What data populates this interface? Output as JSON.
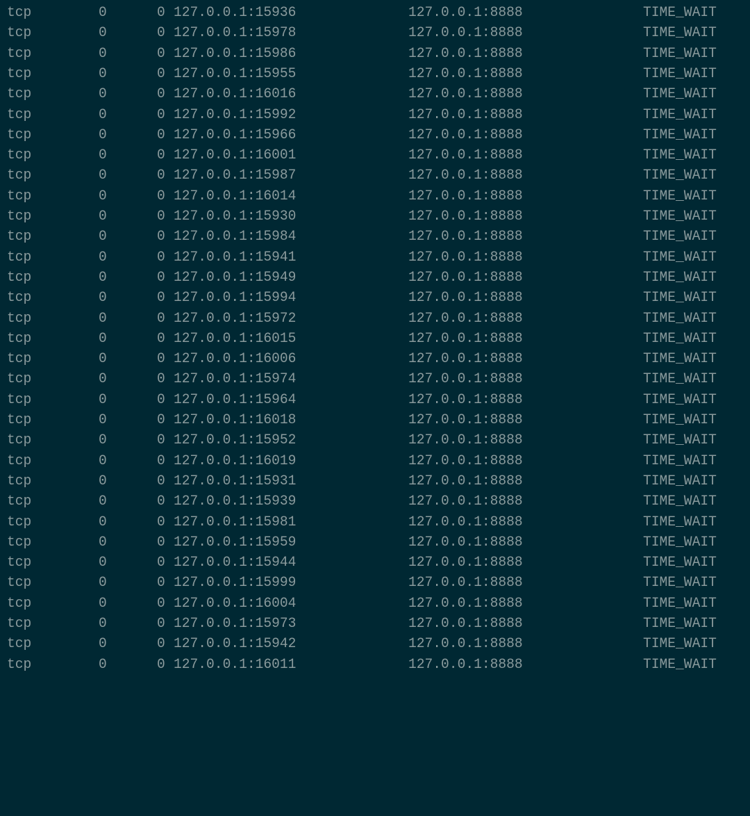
{
  "window": {
    "type": "terminal",
    "command_output": "netstat"
  },
  "theme": {
    "background": "#002833",
    "foreground": "#8a9a9c"
  },
  "connections": [
    {
      "proto": "tcp",
      "recv_q": "0",
      "send_q": "0",
      "local_address": "127.0.0.1:15936",
      "foreign_address": "127.0.0.1:8888",
      "state": "TIME_WAIT"
    },
    {
      "proto": "tcp",
      "recv_q": "0",
      "send_q": "0",
      "local_address": "127.0.0.1:15978",
      "foreign_address": "127.0.0.1:8888",
      "state": "TIME_WAIT"
    },
    {
      "proto": "tcp",
      "recv_q": "0",
      "send_q": "0",
      "local_address": "127.0.0.1:15986",
      "foreign_address": "127.0.0.1:8888",
      "state": "TIME_WAIT"
    },
    {
      "proto": "tcp",
      "recv_q": "0",
      "send_q": "0",
      "local_address": "127.0.0.1:15955",
      "foreign_address": "127.0.0.1:8888",
      "state": "TIME_WAIT"
    },
    {
      "proto": "tcp",
      "recv_q": "0",
      "send_q": "0",
      "local_address": "127.0.0.1:16016",
      "foreign_address": "127.0.0.1:8888",
      "state": "TIME_WAIT"
    },
    {
      "proto": "tcp",
      "recv_q": "0",
      "send_q": "0",
      "local_address": "127.0.0.1:15992",
      "foreign_address": "127.0.0.1:8888",
      "state": "TIME_WAIT"
    },
    {
      "proto": "tcp",
      "recv_q": "0",
      "send_q": "0",
      "local_address": "127.0.0.1:15966",
      "foreign_address": "127.0.0.1:8888",
      "state": "TIME_WAIT"
    },
    {
      "proto": "tcp",
      "recv_q": "0",
      "send_q": "0",
      "local_address": "127.0.0.1:16001",
      "foreign_address": "127.0.0.1:8888",
      "state": "TIME_WAIT"
    },
    {
      "proto": "tcp",
      "recv_q": "0",
      "send_q": "0",
      "local_address": "127.0.0.1:15987",
      "foreign_address": "127.0.0.1:8888",
      "state": "TIME_WAIT"
    },
    {
      "proto": "tcp",
      "recv_q": "0",
      "send_q": "0",
      "local_address": "127.0.0.1:16014",
      "foreign_address": "127.0.0.1:8888",
      "state": "TIME_WAIT"
    },
    {
      "proto": "tcp",
      "recv_q": "0",
      "send_q": "0",
      "local_address": "127.0.0.1:15930",
      "foreign_address": "127.0.0.1:8888",
      "state": "TIME_WAIT"
    },
    {
      "proto": "tcp",
      "recv_q": "0",
      "send_q": "0",
      "local_address": "127.0.0.1:15984",
      "foreign_address": "127.0.0.1:8888",
      "state": "TIME_WAIT"
    },
    {
      "proto": "tcp",
      "recv_q": "0",
      "send_q": "0",
      "local_address": "127.0.0.1:15941",
      "foreign_address": "127.0.0.1:8888",
      "state": "TIME_WAIT"
    },
    {
      "proto": "tcp",
      "recv_q": "0",
      "send_q": "0",
      "local_address": "127.0.0.1:15949",
      "foreign_address": "127.0.0.1:8888",
      "state": "TIME_WAIT"
    },
    {
      "proto": "tcp",
      "recv_q": "0",
      "send_q": "0",
      "local_address": "127.0.0.1:15994",
      "foreign_address": "127.0.0.1:8888",
      "state": "TIME_WAIT"
    },
    {
      "proto": "tcp",
      "recv_q": "0",
      "send_q": "0",
      "local_address": "127.0.0.1:15972",
      "foreign_address": "127.0.0.1:8888",
      "state": "TIME_WAIT"
    },
    {
      "proto": "tcp",
      "recv_q": "0",
      "send_q": "0",
      "local_address": "127.0.0.1:16015",
      "foreign_address": "127.0.0.1:8888",
      "state": "TIME_WAIT"
    },
    {
      "proto": "tcp",
      "recv_q": "0",
      "send_q": "0",
      "local_address": "127.0.0.1:16006",
      "foreign_address": "127.0.0.1:8888",
      "state": "TIME_WAIT"
    },
    {
      "proto": "tcp",
      "recv_q": "0",
      "send_q": "0",
      "local_address": "127.0.0.1:15974",
      "foreign_address": "127.0.0.1:8888",
      "state": "TIME_WAIT"
    },
    {
      "proto": "tcp",
      "recv_q": "0",
      "send_q": "0",
      "local_address": "127.0.0.1:15964",
      "foreign_address": "127.0.0.1:8888",
      "state": "TIME_WAIT"
    },
    {
      "proto": "tcp",
      "recv_q": "0",
      "send_q": "0",
      "local_address": "127.0.0.1:16018",
      "foreign_address": "127.0.0.1:8888",
      "state": "TIME_WAIT"
    },
    {
      "proto": "tcp",
      "recv_q": "0",
      "send_q": "0",
      "local_address": "127.0.0.1:15952",
      "foreign_address": "127.0.0.1:8888",
      "state": "TIME_WAIT"
    },
    {
      "proto": "tcp",
      "recv_q": "0",
      "send_q": "0",
      "local_address": "127.0.0.1:16019",
      "foreign_address": "127.0.0.1:8888",
      "state": "TIME_WAIT"
    },
    {
      "proto": "tcp",
      "recv_q": "0",
      "send_q": "0",
      "local_address": "127.0.0.1:15931",
      "foreign_address": "127.0.0.1:8888",
      "state": "TIME_WAIT"
    },
    {
      "proto": "tcp",
      "recv_q": "0",
      "send_q": "0",
      "local_address": "127.0.0.1:15939",
      "foreign_address": "127.0.0.1:8888",
      "state": "TIME_WAIT"
    },
    {
      "proto": "tcp",
      "recv_q": "0",
      "send_q": "0",
      "local_address": "127.0.0.1:15981",
      "foreign_address": "127.0.0.1:8888",
      "state": "TIME_WAIT"
    },
    {
      "proto": "tcp",
      "recv_q": "0",
      "send_q": "0",
      "local_address": "127.0.0.1:15959",
      "foreign_address": "127.0.0.1:8888",
      "state": "TIME_WAIT"
    },
    {
      "proto": "tcp",
      "recv_q": "0",
      "send_q": "0",
      "local_address": "127.0.0.1:15944",
      "foreign_address": "127.0.0.1:8888",
      "state": "TIME_WAIT"
    },
    {
      "proto": "tcp",
      "recv_q": "0",
      "send_q": "0",
      "local_address": "127.0.0.1:15999",
      "foreign_address": "127.0.0.1:8888",
      "state": "TIME_WAIT"
    },
    {
      "proto": "tcp",
      "recv_q": "0",
      "send_q": "0",
      "local_address": "127.0.0.1:16004",
      "foreign_address": "127.0.0.1:8888",
      "state": "TIME_WAIT"
    },
    {
      "proto": "tcp",
      "recv_q": "0",
      "send_q": "0",
      "local_address": "127.0.0.1:15973",
      "foreign_address": "127.0.0.1:8888",
      "state": "TIME_WAIT"
    },
    {
      "proto": "tcp",
      "recv_q": "0",
      "send_q": "0",
      "local_address": "127.0.0.1:15942",
      "foreign_address": "127.0.0.1:8888",
      "state": "TIME_WAIT"
    },
    {
      "proto": "tcp",
      "recv_q": "0",
      "send_q": "0",
      "local_address": "127.0.0.1:16011",
      "foreign_address": "127.0.0.1:8888",
      "state": "TIME_WAIT"
    }
  ]
}
